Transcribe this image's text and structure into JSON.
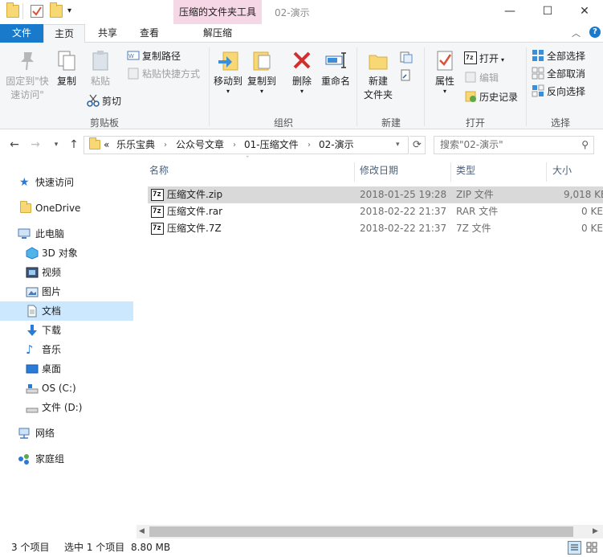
{
  "window": {
    "title": "02-演示",
    "context_tab_header": "压缩的文件夹工具",
    "minimize": "—",
    "maximize": "☐",
    "close": "✕"
  },
  "tabs": {
    "file": "文件",
    "home": "主页",
    "share": "共享",
    "view": "查看",
    "extract": "解压缩"
  },
  "ribbon": {
    "clipboard": {
      "label": "剪贴板",
      "pin": "固定到\"快速访问\"",
      "copy": "复制",
      "paste": "粘贴",
      "copy_path": "复制路径",
      "paste_shortcut": "粘贴快捷方式",
      "cut": "剪切"
    },
    "organize": {
      "label": "组织",
      "move_to": "移动到",
      "copy_to": "复制到",
      "delete": "删除",
      "rename": "重命名"
    },
    "new": {
      "label": "新建",
      "new_folder_line1": "新建",
      "new_folder_line2": "文件夹"
    },
    "open": {
      "label": "打开",
      "properties": "属性",
      "open": "打开",
      "edit": "编辑",
      "history": "历史记录"
    },
    "select": {
      "label": "选择",
      "select_all": "全部选择",
      "select_none": "全部取消",
      "invert": "反向选择"
    }
  },
  "address": {
    "overflow": "«",
    "crumbs": [
      "乐乐宝典",
      "公众号文章",
      "01-压缩文件",
      "02-演示"
    ],
    "search_placeholder": "搜索\"02-演示\""
  },
  "nav_pane": {
    "quick_access": "快速访问",
    "onedrive": "OneDrive",
    "this_pc": "此电脑",
    "objects_3d": "3D 对象",
    "videos": "视频",
    "pictures": "图片",
    "documents": "文档",
    "downloads": "下载",
    "music": "音乐",
    "desktop": "桌面",
    "drive_c": "OS (C:)",
    "drive_d": "文件 (D:)",
    "network": "网络",
    "homegroup": "家庭组"
  },
  "columns": {
    "name": "名称",
    "date": "修改日期",
    "type": "类型",
    "size": "大小"
  },
  "files": [
    {
      "name": "压缩文件.zip",
      "date": "2018-01-25 19:28",
      "type": "ZIP 文件",
      "size": "9,018 KE"
    },
    {
      "name": "压缩文件.rar",
      "date": "2018-02-22 21:37",
      "type": "RAR 文件",
      "size": "0 KE"
    },
    {
      "name": "压缩文件.7Z",
      "date": "2018-02-22 21:37",
      "type": "7Z 文件",
      "size": "0 KE"
    }
  ],
  "status": {
    "item_count": "3 个项目",
    "selection": "选中 1 个项目",
    "selection_size": "8.80 MB"
  },
  "colors": {
    "file_tab": "#1979ca",
    "context_tab": "#f6d7e6",
    "selection": "#cce8ff",
    "row_selected": "#d9d9d9"
  }
}
